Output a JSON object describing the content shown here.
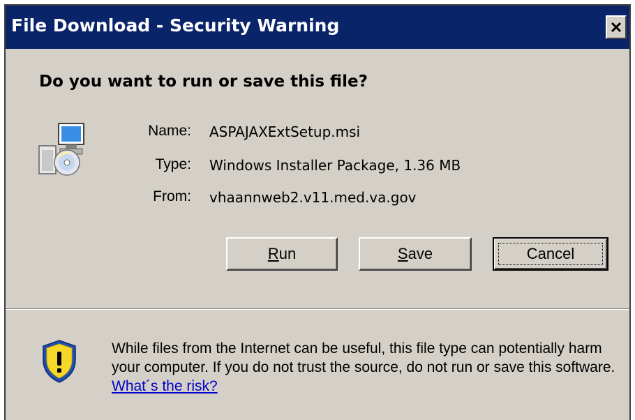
{
  "window": {
    "title": "File Download - Security Warning",
    "close_label": "close",
    "colors": {
      "titlebar": "#0a246a",
      "face": "#d4d0c8",
      "link": "#0000cc"
    }
  },
  "dialog": {
    "question": "Do you want to run or save this file?",
    "file_icon": "installer-package-icon",
    "fields": [
      {
        "label": "Name:",
        "value": "ASPAJAXExtSetup.msi"
      },
      {
        "label": "Type:",
        "value": "Windows Installer Package, 1.36 MB"
      },
      {
        "label": "From:",
        "value": "vhaannweb2.v11.med.va.gov"
      }
    ],
    "buttons": {
      "run": {
        "mnemonic": "R",
        "rest": "un"
      },
      "save": {
        "mnemonic": "S",
        "rest": "ave"
      },
      "cancel": "Cancel"
    }
  },
  "warning": {
    "icon": "security-shield-icon",
    "text": "While files from the Internet can be useful, this file type can potentially harm your computer. If you do not trust the source, do not run or save this software.",
    "link": "What´s the risk?"
  }
}
